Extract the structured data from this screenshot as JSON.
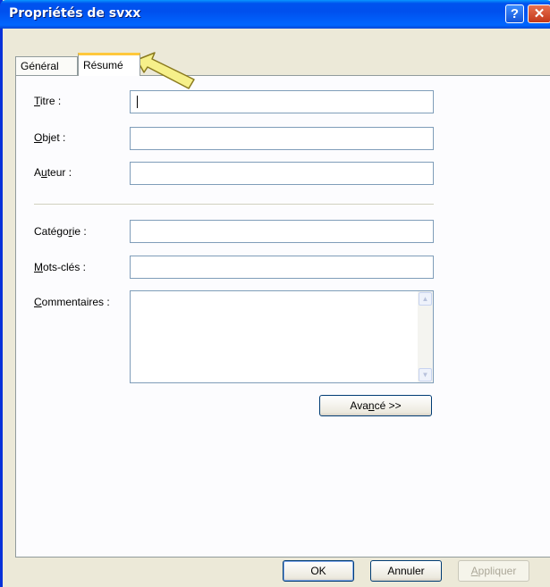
{
  "window": {
    "title": "Propriétés de svxx",
    "help_glyph": "?",
    "close_glyph": "✕"
  },
  "tabs": [
    {
      "label": "Général"
    },
    {
      "label": "Résumé"
    }
  ],
  "fields": {
    "titre": {
      "pre": "",
      "u": "T",
      "post": "itre :",
      "value": ""
    },
    "objet": {
      "pre": "",
      "u": "O",
      "post": "bjet :",
      "value": ""
    },
    "auteur": {
      "pre": "A",
      "u": "u",
      "post": "teur :",
      "value": ""
    },
    "categorie": {
      "pre": "Catégo",
      "u": "r",
      "post": "ie :",
      "value": ""
    },
    "mots_cles": {
      "pre": "",
      "u": "M",
      "post": "ots-clés :",
      "value": ""
    },
    "commentaires": {
      "pre": "",
      "u": "C",
      "post": "ommentaires :",
      "value": ""
    }
  },
  "advanced_button": {
    "pre": "Ava",
    "u": "n",
    "post": "cé >>"
  },
  "footer": {
    "ok": "OK",
    "annuler": "Annuler",
    "appliquer_u": "A",
    "appliquer_post": "ppliquer"
  },
  "annotation": {
    "color": "#f6f08a",
    "stroke": "#8a7a1e"
  }
}
